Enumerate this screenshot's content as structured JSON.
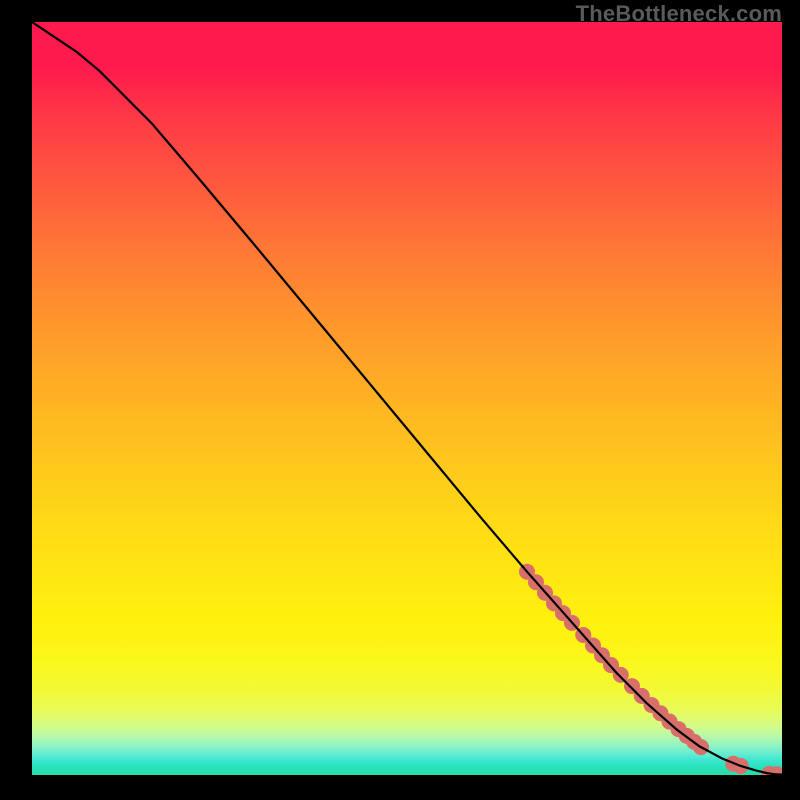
{
  "watermark": "TheBottleneck.com",
  "chart_data": {
    "type": "line",
    "title": "",
    "xlabel": "",
    "ylabel": "",
    "xlim": [
      0,
      100
    ],
    "ylim": [
      0,
      100
    ],
    "grid": false,
    "legend": false,
    "series": [
      {
        "name": "curve",
        "kind": "line",
        "color": "#000000",
        "x": [
          0,
          3,
          6,
          9,
          12,
          16,
          22,
          30,
          40,
          50,
          60,
          66,
          70,
          74,
          78,
          82,
          86,
          89,
          92,
          94.5,
          96.5,
          98,
          99,
          100
        ],
        "y": [
          100,
          98,
          96,
          93.5,
          90.5,
          86.5,
          79.5,
          70,
          58,
          46,
          34,
          27,
          22.5,
          18,
          13.5,
          9.5,
          6,
          3.8,
          2.2,
          1.2,
          0.6,
          0.25,
          0.1,
          0.05
        ]
      },
      {
        "name": "points",
        "kind": "scatter",
        "color": "#d86f6b",
        "radius": 8,
        "x": [
          66,
          67.2,
          68.4,
          69.6,
          70.8,
          72,
          73.5,
          74.8,
          76,
          77.2,
          78.5,
          80,
          81.3,
          82.6,
          83.8,
          85,
          86.2,
          87.3,
          88.3,
          89.2,
          93.5,
          94.5,
          98.3,
          99.3
        ],
        "y": [
          27,
          25.6,
          24.2,
          22.8,
          21.5,
          20.2,
          18.6,
          17.2,
          15.9,
          14.6,
          13.3,
          11.8,
          10.5,
          9.3,
          8.2,
          7.1,
          6.1,
          5.2,
          4.4,
          3.7,
          1.5,
          1.2,
          0.15,
          0.1
        ]
      }
    ]
  }
}
